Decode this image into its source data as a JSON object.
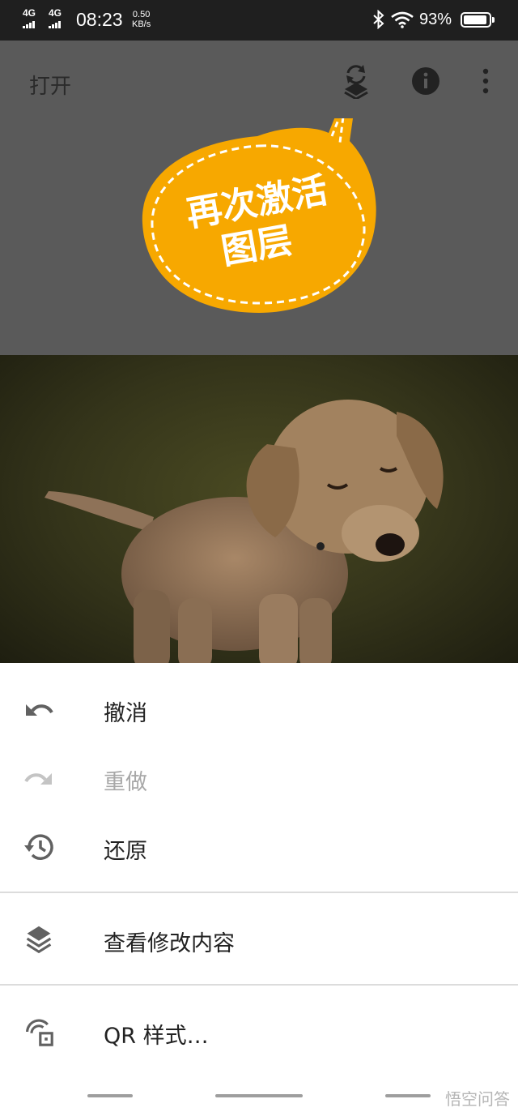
{
  "status_bar": {
    "signal1": "4G",
    "signal2": "4G",
    "time": "08:23",
    "speed_value": "0.50",
    "speed_unit": "KB/s",
    "battery": "93%",
    "battery_level": 0.93
  },
  "toolbar": {
    "open_label": "打开",
    "icons": [
      "layers-swap-icon",
      "info-icon",
      "more-vert-icon"
    ]
  },
  "callout": {
    "line1": "再次激活",
    "line2": "图层",
    "color": "#f7a800"
  },
  "menu": {
    "items": [
      {
        "label": "撤消",
        "icon": "undo-icon",
        "enabled": true
      },
      {
        "label": "重做",
        "icon": "redo-icon",
        "enabled": false
      },
      {
        "label": "还原",
        "icon": "history-icon",
        "enabled": true
      },
      {
        "label": "查看修改内容",
        "icon": "layers-icon",
        "enabled": true
      },
      {
        "label": "QR 样式…",
        "icon": "qr-style-icon",
        "enabled": true
      }
    ]
  },
  "watermark": "悟空问答"
}
